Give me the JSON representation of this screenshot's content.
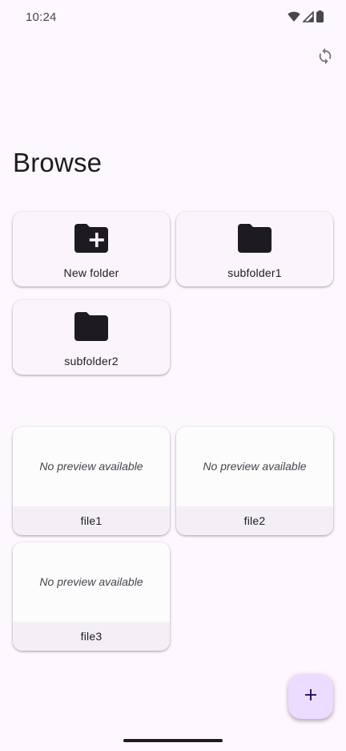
{
  "status_bar": {
    "time": "10:24",
    "icons": [
      "wifi-icon",
      "signal-icon",
      "battery-icon"
    ]
  },
  "header": {
    "refresh_icon": "sync-icon"
  },
  "page": {
    "title": "Browse"
  },
  "folders": [
    {
      "label": "New folder",
      "icon": "create-new-folder-icon"
    },
    {
      "label": "subfolder1",
      "icon": "folder-icon"
    },
    {
      "label": "subfolder2",
      "icon": "folder-icon"
    }
  ],
  "files": [
    {
      "name": "file1",
      "preview": "No preview available"
    },
    {
      "name": "file2",
      "preview": "No preview available"
    },
    {
      "name": "file3",
      "preview": "No preview available"
    }
  ],
  "fab": {
    "icon": "add-icon"
  },
  "colors": {
    "background": "#fdf7fe",
    "card": "#fbf4fc",
    "fab": "#eaddff",
    "icon": "#1d1b20"
  }
}
